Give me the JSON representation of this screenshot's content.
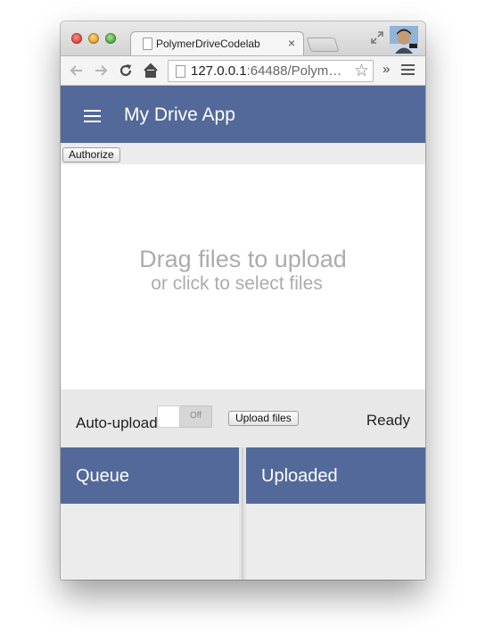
{
  "browser": {
    "tab_title": "PolymerDriveCodelab",
    "tab_close": "×",
    "url_host": "127.0.0.1",
    "url_rest": ":64488/Polym…",
    "overflow_chevrons": "»",
    "icons": [
      "back-icon",
      "forward-icon",
      "reload-icon",
      "home-icon",
      "page-icon",
      "star-icon",
      "menu-icon",
      "fullscreen-icon",
      "avatar"
    ]
  },
  "app": {
    "title": "My Drive App",
    "primary_color": "#53699a",
    "authorize_label": "Authorize",
    "dropzone": {
      "main_text": "Drag files to upload",
      "sub_text": "or click to select files"
    },
    "controls": {
      "auto_upload_label": "Auto-upload",
      "toggle_text": "Off",
      "upload_button": "Upload files",
      "status": "Ready"
    },
    "panels": {
      "queue_title": "Queue",
      "uploaded_title": "Uploaded"
    }
  }
}
